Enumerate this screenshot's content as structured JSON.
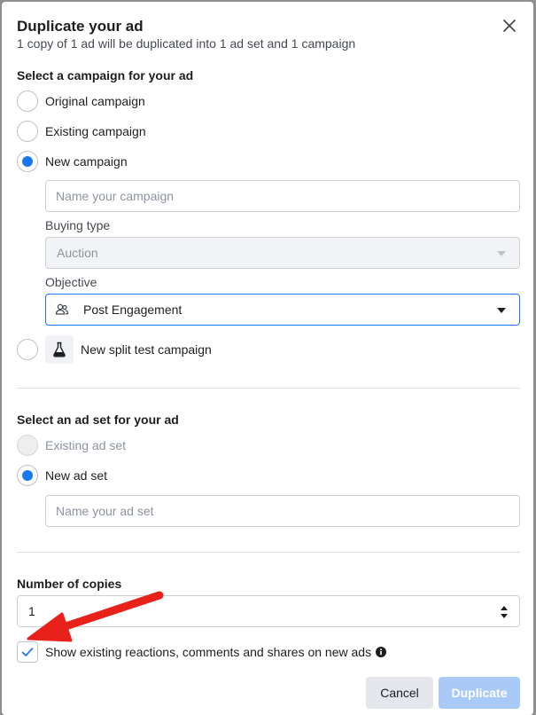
{
  "dialog": {
    "title": "Duplicate your ad",
    "subtitle": "1 copy of 1 ad will be duplicated into 1 ad set and 1 campaign"
  },
  "campaign_section": {
    "label": "Select a campaign for your ad",
    "options": [
      {
        "label": "Original campaign",
        "selected": false
      },
      {
        "label": "Existing campaign",
        "selected": false
      },
      {
        "label": "New campaign",
        "selected": true
      }
    ],
    "name_placeholder": "Name your campaign",
    "buying_type_label": "Buying type",
    "buying_type_value": "Auction",
    "objective_label": "Objective",
    "objective_value": "Post Engagement",
    "split_test_label": "New split test campaign"
  },
  "adset_section": {
    "label": "Select an ad set for your ad",
    "options": [
      {
        "label": "Existing ad set",
        "selected": false,
        "disabled": true
      },
      {
        "label": "New ad set",
        "selected": true
      }
    ],
    "name_placeholder": "Name your ad set"
  },
  "copies": {
    "label": "Number of copies",
    "value": "1"
  },
  "show_reactions": {
    "label": "Show existing reactions, comments and shares on new ads",
    "checked": true
  },
  "buttons": {
    "cancel": "Cancel",
    "duplicate": "Duplicate"
  },
  "colors": {
    "accent": "#1877f2",
    "arrow": "#e8211b"
  },
  "icons": {
    "close": "close-icon",
    "objective": "people-icon",
    "split_test": "flask-icon",
    "info": "info-icon"
  }
}
